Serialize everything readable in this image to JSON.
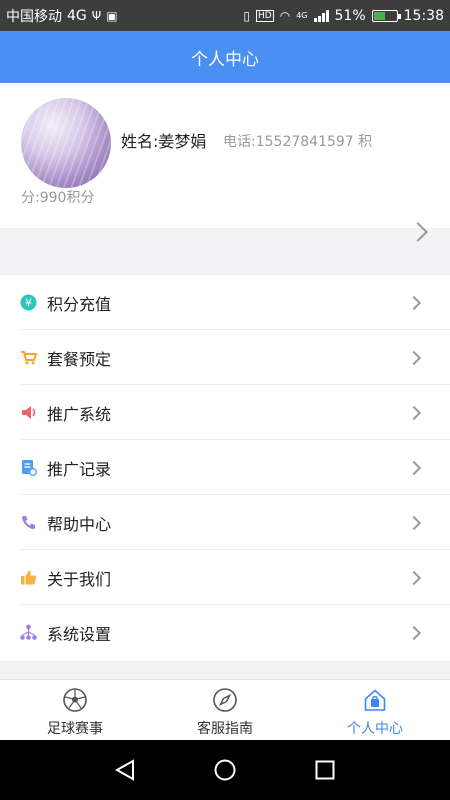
{
  "status_bar": {
    "carrier": "中国移动",
    "network": "4G",
    "network_small": "4G",
    "hd": "HD",
    "battery": "51%",
    "time": "15:38",
    "battery_level": 0.51
  },
  "header": {
    "title": "个人中心"
  },
  "profile": {
    "name": "姓名:姜梦娟",
    "phone": "电话:15527841597  积",
    "points": "分:990积分"
  },
  "menu": {
    "items": [
      {
        "label": "积分充值",
        "icon": "points-recharge-icon",
        "color": "#2ec4b6"
      },
      {
        "label": "套餐预定",
        "icon": "cart-icon",
        "color": "#f5a623"
      },
      {
        "label": "推广系统",
        "icon": "speaker-icon",
        "color": "#ef6461"
      },
      {
        "label": "推广记录",
        "icon": "record-icon",
        "color": "#4a9ff2"
      },
      {
        "label": "帮助中心",
        "icon": "phone-icon",
        "color": "#a07ee0"
      },
      {
        "label": "关于我们",
        "icon": "thumbs-up-icon",
        "color": "#f5b33b"
      },
      {
        "label": "系统设置",
        "icon": "network-icon",
        "color": "#a07ee0"
      }
    ]
  },
  "tabs": [
    {
      "label": "足球赛事",
      "icon": "soccer-ball-icon",
      "active": false
    },
    {
      "label": "客服指南",
      "icon": "compass-icon",
      "active": false
    },
    {
      "label": "个人中心",
      "icon": "home-bag-icon",
      "active": true
    }
  ],
  "colors": {
    "primary": "#4a8ff2",
    "active_tab": "#3f87f0",
    "secondary_text": "#999999"
  }
}
